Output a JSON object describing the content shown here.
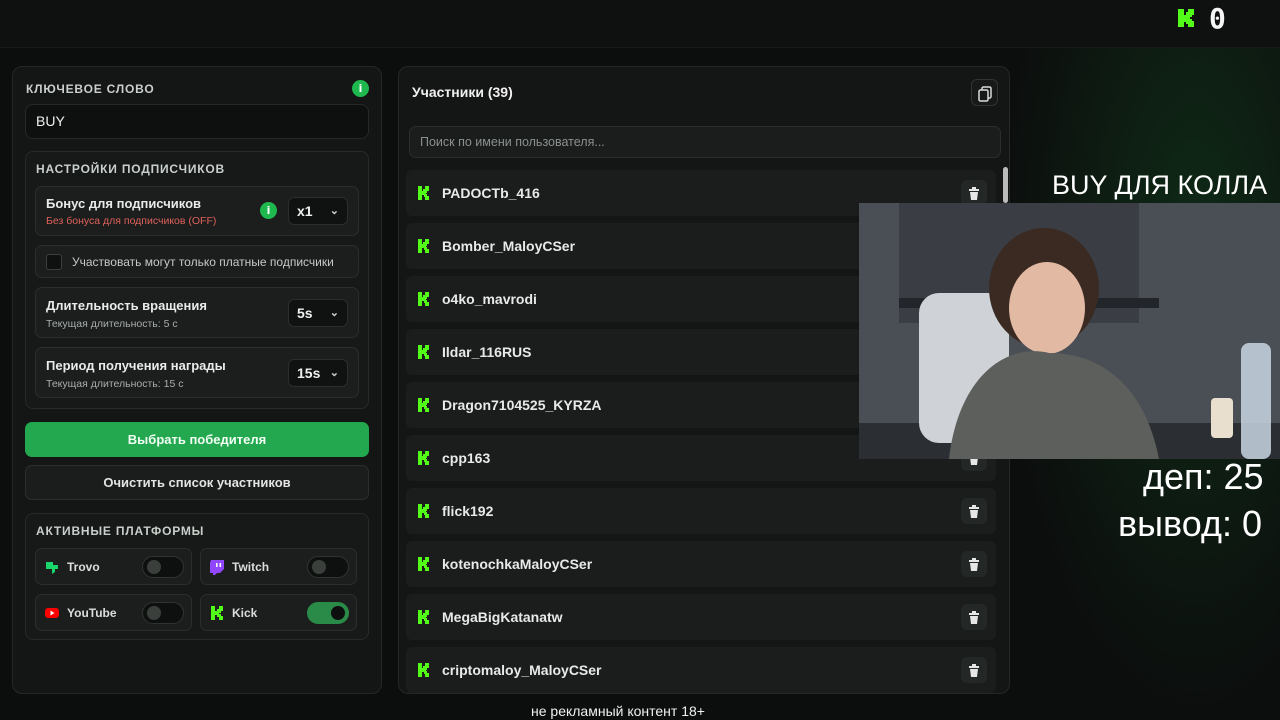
{
  "header": {
    "counter": "0",
    "brand_icon": "kick-logo-icon"
  },
  "left": {
    "keyword_title": "КЛЮЧЕВОЕ СЛОВО",
    "info_glyph": "i",
    "keyword_value": "BUY",
    "sub_settings_title": "НАСТРОЙКИ ПОДПИСЧИКОВ",
    "bonus": {
      "title": "Бонус для подписчиков",
      "subtitle": "Без бонуса для подписчиков (OFF)",
      "value": "x1"
    },
    "paid_only_label": "Участвовать могут только платные подписчики",
    "spin": {
      "title": "Длительность вращения",
      "subtitle": "Текущая длительность: 5 с",
      "value": "5s"
    },
    "reward": {
      "title": "Период получения награды",
      "subtitle": "Текущая длительность: 15 с",
      "value": "15s"
    },
    "pick_winner_label": "Выбрать победителя",
    "clear_label": "Очистить список участников",
    "platforms_title": "АКТИВНЫЕ ПЛАТФОРМЫ",
    "platforms": [
      {
        "label": "Trovo",
        "icon": "trovo-icon",
        "enabled": false,
        "color": "#19d66b"
      },
      {
        "label": "Twitch",
        "icon": "twitch-icon",
        "enabled": false,
        "color": "#9146ff"
      },
      {
        "label": "YouTube",
        "icon": "youtube-icon",
        "enabled": false,
        "color": "#ff0000"
      },
      {
        "label": "Kick",
        "icon": "kick-icon",
        "enabled": true,
        "color": "#53fc18"
      }
    ]
  },
  "participants": {
    "title": "Участники (39)",
    "search_placeholder": "Поиск по имени пользователя...",
    "items": [
      "PADOCTb_416",
      "Bomber_MaloyCSer",
      "o4ko_mavrodi",
      "Ildar_116RUS",
      "Dragon7104525_KYRZA",
      "cpp163",
      "flick192",
      "kotenochkaMaloyCSer",
      "MegaBigKatanatw",
      "criptomaloy_MaloyCSer"
    ]
  },
  "overlay": {
    "keyword_text": "BUY ДЛЯ КОЛЛА",
    "dep_text": "деп: 25",
    "out_text": "вывод: 0",
    "disclaimer": "не рекламный контент 18+"
  },
  "colors": {
    "accent": "#23a84f",
    "kick_green": "#53fc18",
    "danger_text": "#e0605a"
  }
}
